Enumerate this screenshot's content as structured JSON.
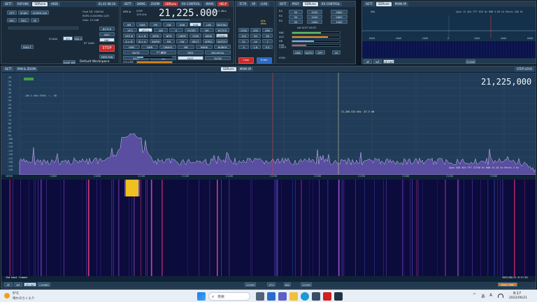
{
  "panels": {
    "p1": {
      "tabs": [
        "SETT",
        "RXFUNC",
        "SDRuno",
        "HIDE"
      ],
      "time": "01.41 08:16"
    },
    "p2": {
      "tabs": [
        "SETT",
        "SKINS",
        "ZOOM",
        "SDRuno",
        "RX CONTROL",
        "WAVE",
        "HELP"
      ]
    },
    "p3": {
      "tabs": [
        "TCTR",
        "SP"
      ],
      "meter": "0.00"
    },
    "p4": {
      "tabs": [
        "SETT",
        "PREF",
        "SDRuno",
        "RX CONTROL",
        "AREA"
      ]
    },
    "p5": {
      "tabs": [
        "SETT",
        "SDRuno",
        "MAIN SP"
      ]
    },
    "p6": {
      "tabs": [
        "SETT",
        "PAN & ZOOM",
        "SDRuno",
        "MAIN SP"
      ]
    }
  },
  "ctrl": {
    "opt": "OPT",
    "scan": "SCAN",
    "scheduler": "SCHED ULE",
    "rpc": "RPC",
    "rfg": "RFG",
    "fe": "FE",
    "rate_line1": "Final SR: 200000",
    "rate_line2": "RSPII: 8.000MHz (LIF)",
    "rate_line3": "Gain: 15.0dB",
    "rfgain": "RF GAIN",
    "ifgain": "IFGAIN",
    "stop": "STOP",
    "mem_pan": "MEM PAN",
    "defaults": "Default Workspace",
    "save_ws": "SAVE WS",
    "bias": "BIAS-T",
    "notch": "NOTCH",
    "agc": "AGC",
    "nbc": "NBC",
    "mode_buttons": [
      "IFS",
      "DEL NBM",
      "ZOOM"
    ]
  },
  "rx": {
    "freq": "21,225.000",
    "vfo_label": "VFO A",
    "step_label": "STEP",
    "step_value": "100 kHz",
    "dbm": "-106.5 dBm",
    "modes": [
      "AM",
      "SAM",
      "FM",
      "CW",
      "DSB",
      "USB",
      "LSB",
      "DIGITAL"
    ],
    "row1": [
      "VFO",
      "VFO A",
      "AM",
      "S",
      "FILTER",
      "NR",
      "NOTCH"
    ],
    "row2": [
      "VFO B",
      "A > B",
      "WFM",
      "NFM",
      "CWFK",
      "7200",
      "WIDE",
      "DSBKU"
    ],
    "row3": [
      "A > B",
      "B > A",
      "SWFM",
      "FM",
      "CW",
      "SPLIT",
      "NTRQ",
      "NOTCH"
    ],
    "row4": [
      "QMS",
      "QMR",
      "CWAVG",
      "NB",
      "MARK",
      "NUBKH"
    ],
    "row5": [
      "MUTE",
      "AGC",
      "MED",
      "DELAYCAL"
    ],
    "row6": [
      "SQLT",
      "NB",
      "FAST",
      "SLOW"
    ],
    "volume": "VOLUME",
    "squelch_val": "-81 dBm"
  },
  "keypad": {
    "keys": [
      "1",
      "2",
      "3",
      "4",
      "5",
      "6",
      "7",
      "8",
      "9",
      "Clear",
      "0",
      "Enter"
    ],
    "bands": [
      "1200",
      "430",
      "260",
      "124",
      "50",
      "28",
      "21",
      "14",
      "7",
      "3",
      "1.8",
      "0.5"
    ],
    "mhz": "MHz",
    "khz": "kHz"
  },
  "right_ctrl": {
    "rows": [
      {
        "label": "RX",
        "v1": "50",
        "v2": "3100",
        "v3": "2800"
      },
      {
        "label": "RX",
        "v1": "50",
        "v2": "3100",
        "v3": "2800"
      },
      {
        "label": "RX",
        "v1": "50",
        "v2": "1000",
        "v3": "1000"
      }
    ],
    "title": "AM SOFT MUTE",
    "bars": [
      "NBC",
      "AGC",
      "NB",
      "DSB"
    ],
    "btns": [
      "DSB",
      "AUTO",
      "OFF"
    ],
    "cwfk": "CWFK",
    "sync": "SYNC",
    "bw": "25"
  },
  "mini_spec": {
    "title": "SDRuno",
    "info": "Span 12 kHz  FFT 628 Hz  RBW 9.66 Hz  Marks 200 Hz",
    "ticks": [
      "-6000",
      "-4000",
      "-2000",
      "0",
      "2000",
      "4000",
      "6000"
    ],
    "dbm_top": "dBm"
  },
  "main": {
    "freq_display": "21,225,000",
    "tabs": [
      "SP",
      "WF",
      "SP+WF",
      "COMBO"
    ],
    "zoom": "ZOOM",
    "vfo_btn": "VFO",
    "step_lock": "STEP LOCK",
    "level_info": "-106.5 dBm  SPAN: ~-- dB",
    "marker": "21,206.524 kHz  -67.5 dB",
    "span_info": "Span 500 kHz  FFT 32768 Hz  RBW 15.26 Hz  Marks 2 Hz",
    "db_ticks": [
      "-20",
      "-25",
      "-30",
      "-35",
      "-40",
      "-45",
      "-50",
      "-55",
      "-60",
      "-65",
      "-70",
      "-75",
      "-80",
      "-85",
      "-90",
      "-95",
      "-100",
      "-105",
      "-110",
      "-115",
      "-120",
      "-125",
      "-130",
      "-135",
      "-140"
    ],
    "freq_ticks": [
      "20950",
      "21000",
      "21050",
      "21100",
      "21150",
      "21200",
      "21250",
      "21300",
      "21350",
      "21400",
      "21450",
      "21500"
    ],
    "status_left": "15m band framed",
    "status_right": "2022/06/21 8:17:02",
    "bottom_tabs": [
      "SP",
      "WF",
      "SP+WF",
      "COMBO"
    ],
    "bottom_mid": [
      "ZOOM",
      "VFO",
      "BW",
      "ZOOM"
    ],
    "bottom_right": "SQLC TMC"
  },
  "taskbar": {
    "weather_temp": "5°C",
    "weather_desc": "晴れのちくもり",
    "search_placeholder": "検索",
    "time": "8:17",
    "date": "2022/06/21",
    "tray": [
      "^",
      "あ",
      "A"
    ]
  },
  "colors": {
    "spectrum_fill": "#5a4ea0",
    "waterfall_bg": "#0b0b3c",
    "signal": "#f0c020",
    "accent_red": "#c82828"
  }
}
